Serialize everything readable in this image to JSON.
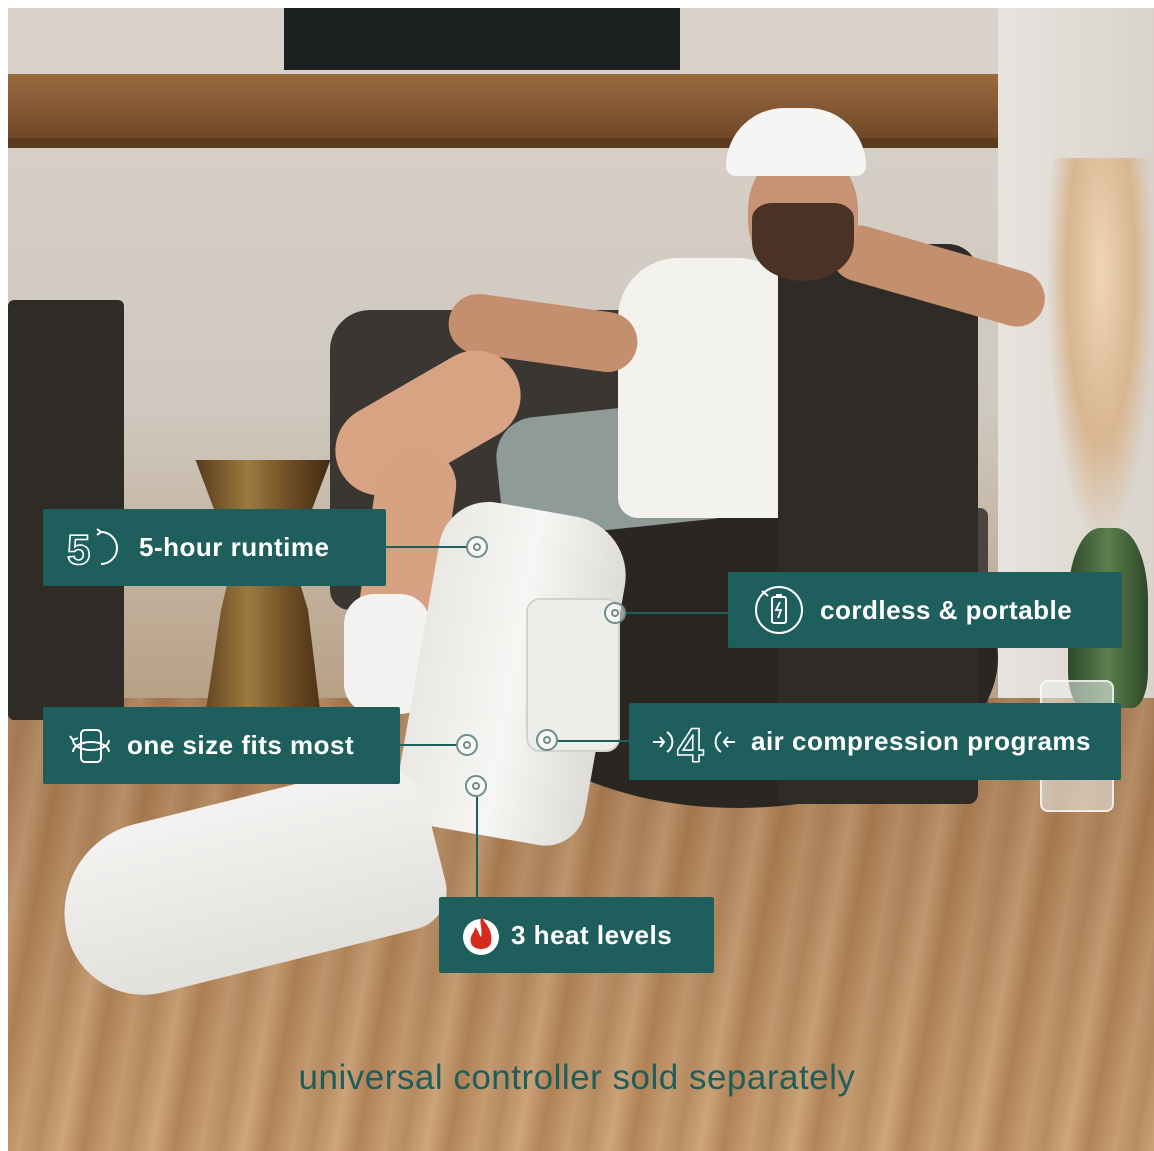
{
  "callouts": {
    "runtime": {
      "label": "5-hour runtime",
      "icon": "clock-5-icon",
      "icon_text": "5"
    },
    "cordless": {
      "label": "cordless & portable",
      "icon": "battery-icon"
    },
    "size": {
      "label": "one size fits most",
      "icon": "wrap-icon"
    },
    "compression": {
      "label": "air compression programs",
      "icon": "compression-4-icon",
      "icon_text": "4"
    },
    "heat": {
      "label": "3 heat levels",
      "icon": "flame-icon"
    }
  },
  "footer": {
    "text": "universal controller sold separately"
  },
  "colors": {
    "panel": "#1e5f5e",
    "footer_text": "#1f5d5c",
    "flame": "#d62a1f"
  }
}
